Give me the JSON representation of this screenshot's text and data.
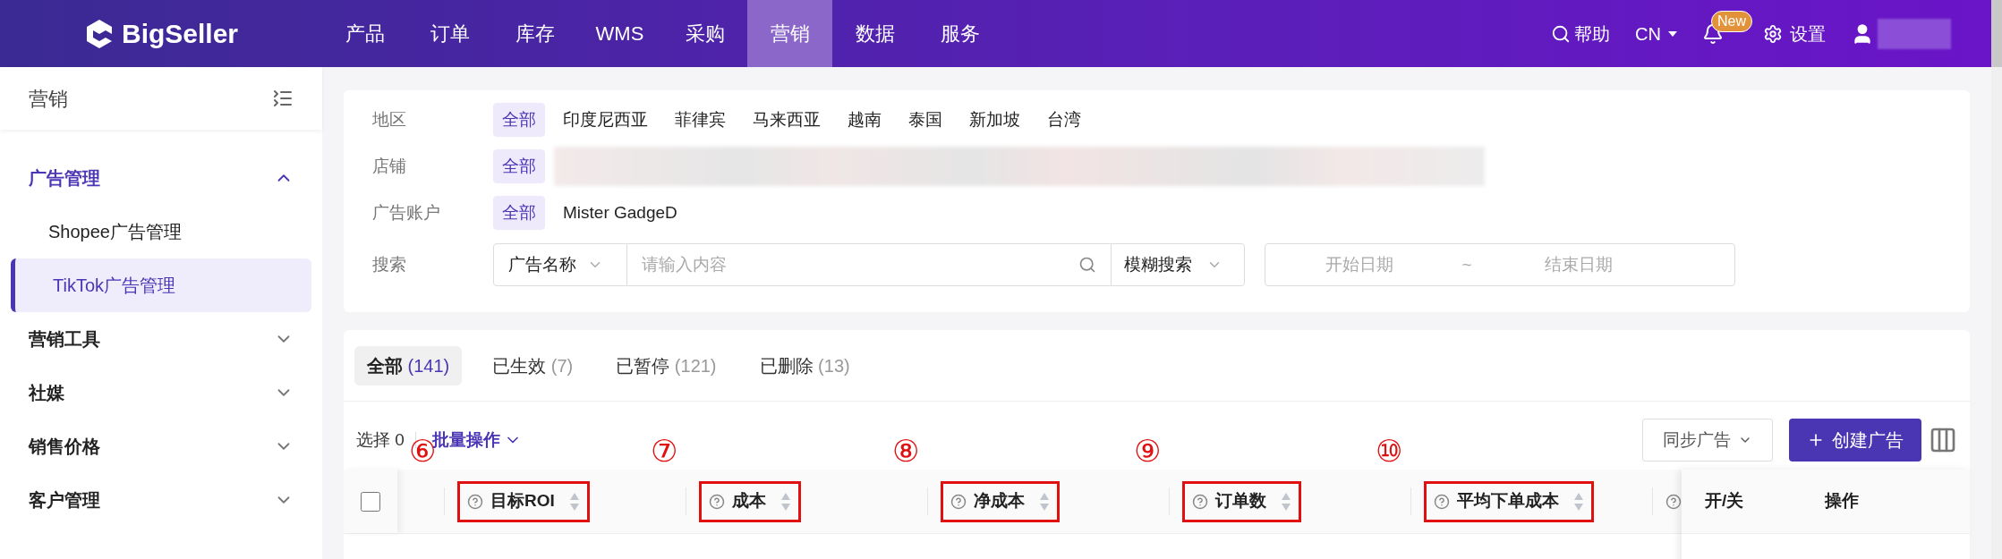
{
  "brand": "BigSeller",
  "nav": [
    {
      "label": "产品",
      "selected": false
    },
    {
      "label": "订单",
      "selected": false
    },
    {
      "label": "库存",
      "selected": false
    },
    {
      "label": "WMS",
      "selected": false
    },
    {
      "label": "采购",
      "selected": false
    },
    {
      "label": "营销",
      "selected": true
    },
    {
      "label": "数据",
      "selected": false
    },
    {
      "label": "服务",
      "selected": false
    }
  ],
  "header_actions": {
    "help": "帮助",
    "language": "CN",
    "badge": "New",
    "settings": "设置"
  },
  "sidebar": {
    "title": "营销",
    "items": [
      {
        "label": "广告管理",
        "expanded": true,
        "children": [
          {
            "label": "Shopee广告管理",
            "selected": false
          },
          {
            "label": "TikTok广告管理",
            "selected": true
          }
        ]
      },
      {
        "label": "营销工具",
        "expanded": false
      },
      {
        "label": "社媒",
        "expanded": false
      },
      {
        "label": "销售价格",
        "expanded": false
      },
      {
        "label": "客户管理",
        "expanded": false
      }
    ]
  },
  "filters": {
    "rows": [
      {
        "label": "地区",
        "options": [
          {
            "label": "全部",
            "selected": true
          },
          {
            "label": "印度尼西亚",
            "selected": false
          },
          {
            "label": "菲律宾",
            "selected": false
          },
          {
            "label": "马来西亚",
            "selected": false
          },
          {
            "label": "越南",
            "selected": false
          },
          {
            "label": "泰国",
            "selected": false
          },
          {
            "label": "新加坡",
            "selected": false
          },
          {
            "label": "台湾",
            "selected": false
          }
        ]
      },
      {
        "label": "店铺",
        "options": [
          {
            "label": "全部",
            "selected": true
          }
        ],
        "redacted": true
      },
      {
        "label": "广告账户",
        "options": [
          {
            "label": "全部",
            "selected": true
          },
          {
            "label": "Mister GadgeD",
            "selected": false
          }
        ]
      }
    ],
    "search": {
      "label": "搜索",
      "field": "广告名称",
      "placeholder": "请输入内容",
      "mode": "模糊搜索",
      "start_placeholder": "开始日期",
      "separator": "~",
      "end_placeholder": "结束日期"
    }
  },
  "status_tabs": [
    {
      "label": "全部",
      "count": "(141)",
      "selected": true
    },
    {
      "label": "已生效",
      "count": "(7)",
      "selected": false
    },
    {
      "label": "已暂停",
      "count": "(121)",
      "selected": false
    },
    {
      "label": "已删除",
      "count": "(13)",
      "selected": false
    }
  ],
  "toolbar": {
    "selected_label": "选择 0",
    "bulk": "批量操作",
    "sync": "同步广告",
    "create": "创建广告"
  },
  "table": {
    "select_all_checked": false,
    "columns": [
      {
        "label": "目标ROI",
        "marker": "⑥"
      },
      {
        "label": "成本",
        "marker": "⑦"
      },
      {
        "label": "净成本",
        "marker": "⑧"
      },
      {
        "label": "订单数",
        "marker": "⑨"
      },
      {
        "label": "平均下单成本",
        "marker": "⑩"
      }
    ],
    "fixed_columns": [
      "开/关",
      "操作"
    ]
  }
}
